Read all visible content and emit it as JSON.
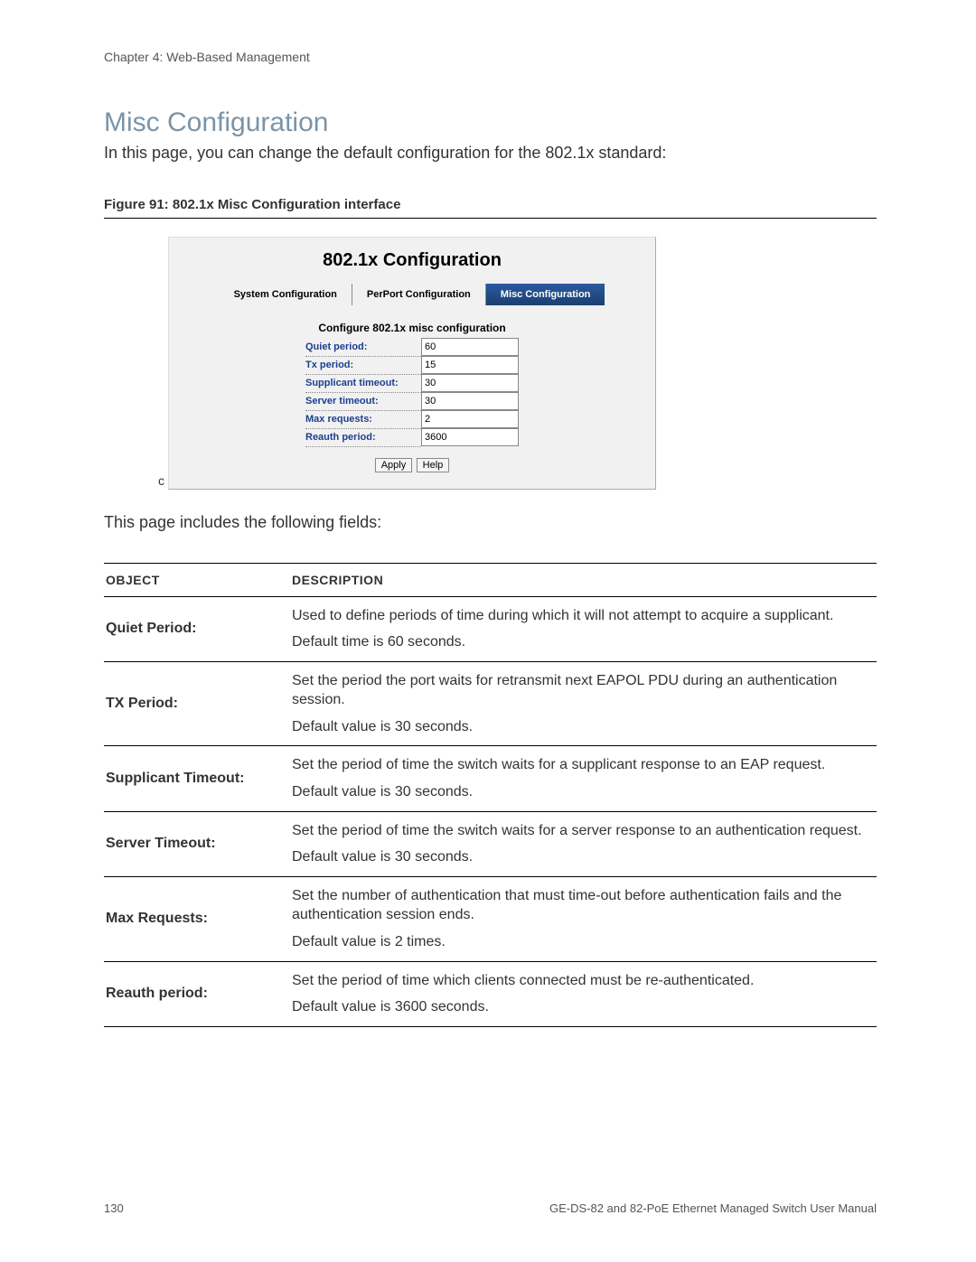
{
  "header": {
    "chapter_line": "Chapter 4: Web-Based Management"
  },
  "section": {
    "title": "Misc Configuration",
    "intro": "In this page, you can change the default configuration for the 802.1x standard:",
    "figure_caption": "Figure 91: 802.1x Misc Configuration interface",
    "fields_intro": "This page includes the following fields:"
  },
  "panel": {
    "title": "802.1x Configuration",
    "tabs": [
      {
        "label": "System Configuration",
        "active": false
      },
      {
        "label": "PerPort Configuration",
        "active": false
      },
      {
        "label": "Misc Configuration",
        "active": true
      }
    ],
    "subtitle": "Configure 802.1x misc configuration",
    "fields": [
      {
        "label": "Quiet period:",
        "value": "60"
      },
      {
        "label": "Tx period:",
        "value": "15"
      },
      {
        "label": "Supplicant timeout:",
        "value": "30"
      },
      {
        "label": "Server timeout:",
        "value": "30"
      },
      {
        "label": "Max requests:",
        "value": "2"
      },
      {
        "label": "Reauth period:",
        "value": "3600"
      }
    ],
    "buttons": {
      "apply": "Apply",
      "help": "Help"
    },
    "stray_c": "c"
  },
  "fields_table": {
    "headers": {
      "object": "OBJECT",
      "description": "DESCRIPTION"
    },
    "rows": [
      {
        "object": "Quiet Period:",
        "desc_main": "Used to define periods of time during which it will not attempt to acquire a supplicant.",
        "desc_sub": "Default time is 60 seconds."
      },
      {
        "object": "TX Period:",
        "desc_main": "Set the period the port waits for retransmit next EAPOL PDU during an authentication session.",
        "desc_sub": "Default value is 30 seconds."
      },
      {
        "object": "Supplicant Timeout:",
        "desc_main": "Set the period of time the switch waits for a supplicant response to an EAP request.",
        "desc_sub": "Default value is 30 seconds."
      },
      {
        "object": "Server Timeout:",
        "desc_main": "Set the period of time the switch waits for a server response to an authentication request.",
        "desc_sub": "Default value is 30 seconds."
      },
      {
        "object": "Max Requests:",
        "desc_main": "Set the number of authentication that must time-out before authentication fails and the authentication session ends.",
        "desc_sub": "Default value is 2 times."
      },
      {
        "object": "Reauth period:",
        "desc_main": "Set the period of time which clients connected must be re-authenticated.",
        "desc_sub": "Default value is 3600 seconds."
      }
    ]
  },
  "footer": {
    "page_number": "130",
    "manual_title": "GE-DS-82 and 82-PoE Ethernet Managed Switch User Manual"
  }
}
